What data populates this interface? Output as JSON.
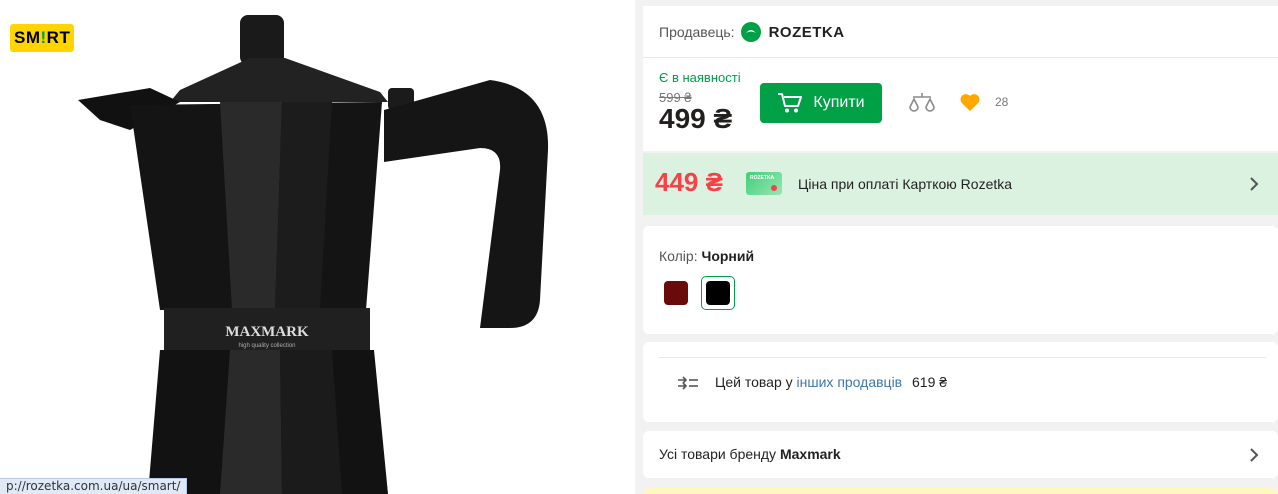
{
  "badge": {
    "text": "SMART"
  },
  "product": {
    "brand_print": "MAXMARK",
    "brand_tagline": "high quality collection"
  },
  "status_bar": {
    "url": "p://rozetka.com.ua/ua/smart/"
  },
  "seller": {
    "label": "Продавець:",
    "name": "ROZETKA"
  },
  "purchase": {
    "availability": "Є в наявності",
    "old_price": "599 ₴",
    "price": "499 ₴",
    "buy_label": "Купити",
    "wishlist_count": "28"
  },
  "promo": {
    "price": "449 ₴",
    "card_label": "ROZETKA",
    "text": "Ціна при оплаті Карткою Rozetka"
  },
  "color": {
    "label": "Колір:",
    "selected": "Чорний",
    "swatches": [
      {
        "name": "burgundy",
        "hex": "#6b0a0a"
      },
      {
        "name": "black",
        "hex": "#000000"
      }
    ]
  },
  "other_sellers": {
    "prefix": "Цей товар у",
    "link": "інших продавців",
    "price": "619 ₴"
  },
  "brand": {
    "prefix": "Усі товари бренду",
    "name": "Maxmark"
  },
  "colors": {
    "accent": "#00a046",
    "promo_price": "#f84147",
    "link": "#3e77aa",
    "promo_bg": "#dcf2e1",
    "wish": "#ffa900"
  }
}
